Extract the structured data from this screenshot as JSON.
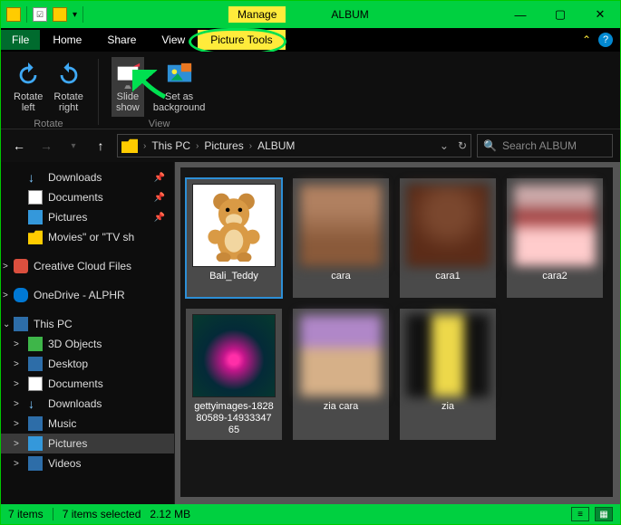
{
  "titlebar": {
    "context_label": "Manage",
    "window_title": "ALBUM",
    "min": "—",
    "max": "▢",
    "close": "✕"
  },
  "menus": {
    "file": "File",
    "tabs": [
      "Home",
      "Share",
      "View"
    ],
    "context_tab": "Picture Tools"
  },
  "ribbon": {
    "rotate_left": "Rotate\nleft",
    "rotate_right": "Rotate\nright",
    "rotate_group": "Rotate",
    "slide_show": "Slide\nshow",
    "set_bg": "Set as\nbackground",
    "view_group": "View"
  },
  "address": {
    "segments": [
      "This PC",
      "Pictures",
      "ALBUM"
    ],
    "search_placeholder": "Search ALBUM"
  },
  "sidebar": {
    "quick": [
      {
        "label": "Downloads",
        "icon": "dl",
        "pinned": true
      },
      {
        "label": "Documents",
        "icon": "doc",
        "pinned": true
      },
      {
        "label": "Pictures",
        "icon": "pic",
        "pinned": true
      },
      {
        "label": "Movies\" or \"TV sh",
        "icon": "folder",
        "pinned": false
      }
    ],
    "cc": "Creative Cloud Files",
    "onedrive": "OneDrive - ALPHR",
    "thispc": "This PC",
    "pcitems": [
      {
        "label": "3D Objects",
        "icon": "obj"
      },
      {
        "label": "Desktop",
        "icon": "desk"
      },
      {
        "label": "Documents",
        "icon": "doc"
      },
      {
        "label": "Downloads",
        "icon": "dl"
      },
      {
        "label": "Music",
        "icon": "music"
      },
      {
        "label": "Pictures",
        "icon": "pic",
        "selected": true
      },
      {
        "label": "Videos",
        "icon": "vid"
      }
    ]
  },
  "items": [
    {
      "label": "Bali_Teddy",
      "style": "teddy",
      "blur": false,
      "selected": true
    },
    {
      "label": "cara",
      "style": "cara",
      "blur": true
    },
    {
      "label": "cara1",
      "style": "cara1",
      "blur": true
    },
    {
      "label": "cara2",
      "style": "cara2",
      "blur": true
    },
    {
      "label": "gettyimages-1828\n80589-14933347\n65",
      "style": "lotus",
      "blur": false
    },
    {
      "label": "zia cara",
      "style": "ziacara",
      "blur": true
    },
    {
      "label": "zia",
      "style": "zia",
      "blur": true
    }
  ],
  "status": {
    "count": "7 items",
    "selected": "7 items selected",
    "size": "2.12 MB"
  }
}
